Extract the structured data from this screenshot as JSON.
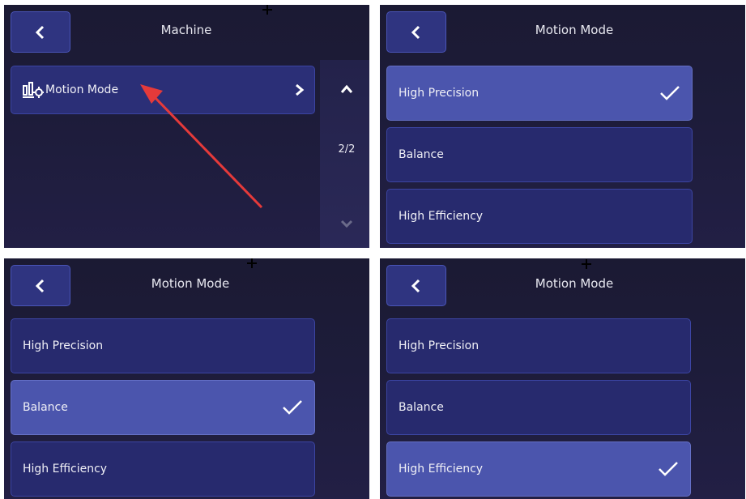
{
  "panel1": {
    "title": "Machine",
    "item_label": "Motion Mode",
    "page_indicator": "2/2",
    "icons": {
      "back": "chevron-left-icon",
      "item": "motion-mode-icon",
      "arrow": "chevron-right-icon",
      "up": "chevron-up-icon",
      "down": "chevron-down-icon"
    }
  },
  "panel2": {
    "title": "Motion Mode",
    "options": [
      "High Precision",
      "Balance",
      "High Efficiency"
    ],
    "selected": "High Precision"
  },
  "panel3": {
    "title": "Motion Mode",
    "options": [
      "High Precision",
      "Balance",
      "High Efficiency"
    ],
    "selected": "Balance"
  },
  "panel4": {
    "title": "Motion Mode",
    "options": [
      "High Precision",
      "Balance",
      "High Efficiency"
    ],
    "selected": "High Efficiency"
  },
  "colors": {
    "button": "#2f3480",
    "item": "#272a6e",
    "selected": "#4b55ad",
    "annotation_arrow": "#e53a3a"
  }
}
